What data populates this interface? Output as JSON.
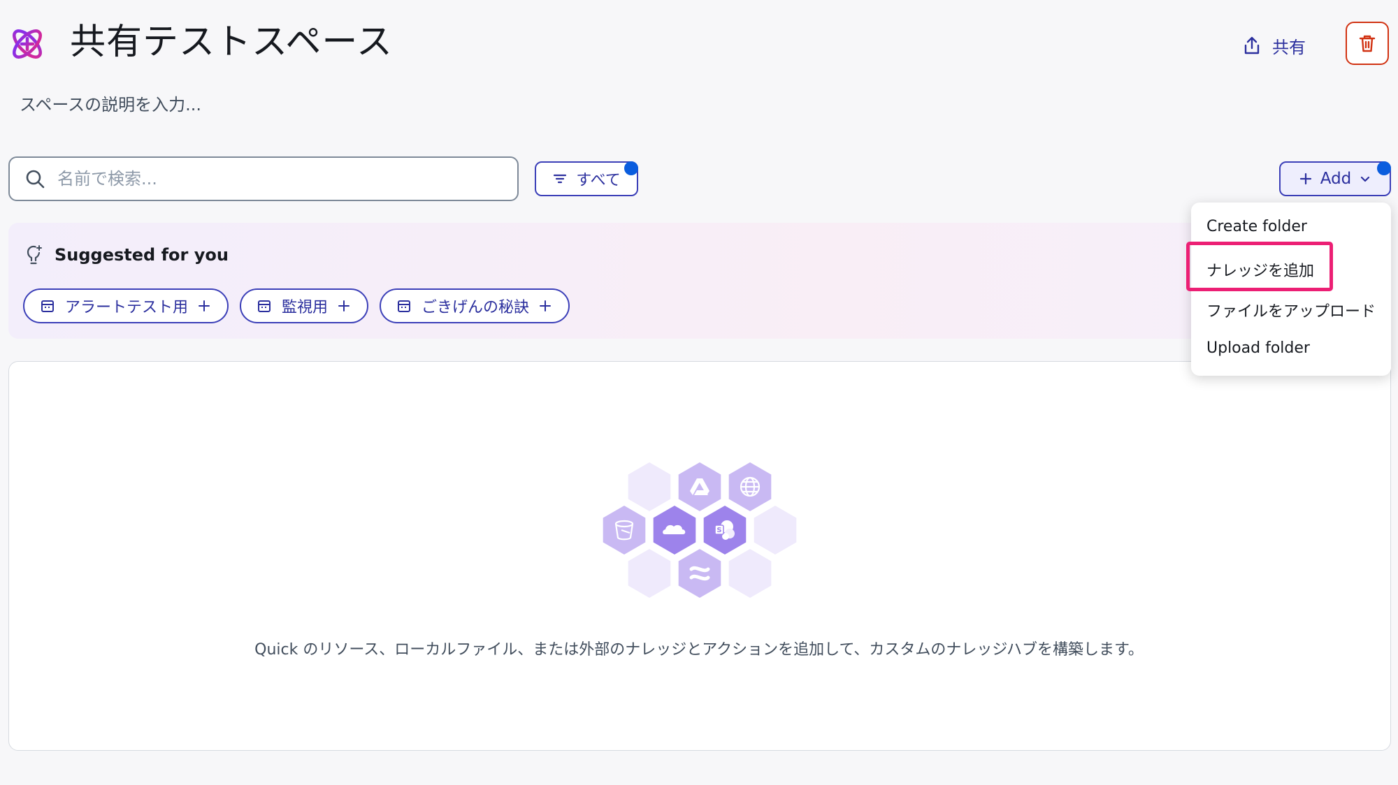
{
  "header": {
    "title": "共有テストスペース",
    "description": "スペースの説明を入力...",
    "share_label": "共有"
  },
  "toolbar": {
    "search_placeholder": "名前で検索...",
    "filter_label": "すべて",
    "add_label": "Add"
  },
  "suggested": {
    "title": "Suggested for you",
    "chips": [
      "アラートテスト用",
      "監視用",
      "ごきげんの秘訣"
    ]
  },
  "add_menu": {
    "items": [
      "Create folder",
      "ナレッジを追加",
      "ファイルをアップロード",
      "Upload folder"
    ],
    "highlighted_item": "ナレッジを追加"
  },
  "empty_state": {
    "message": "Quick のリソース、ローカルファイル、または外部のナレッジとアクションを追加して、カスタムのナレッジハブを構築します。",
    "icons": [
      "google-drive-icon",
      "globe-icon",
      "s3-bucket-icon",
      "onedrive-icon",
      "sharepoint-icon",
      "confluence-icon"
    ]
  },
  "colors": {
    "accent": "#2b2f9e",
    "notification_dot": "#0a5dde",
    "delete": "#d13212",
    "highlight": "#ec1f74",
    "hex_light": "#efeafc",
    "hex_mid": "#c9b9f3",
    "hex_dark": "#9d83eb"
  }
}
